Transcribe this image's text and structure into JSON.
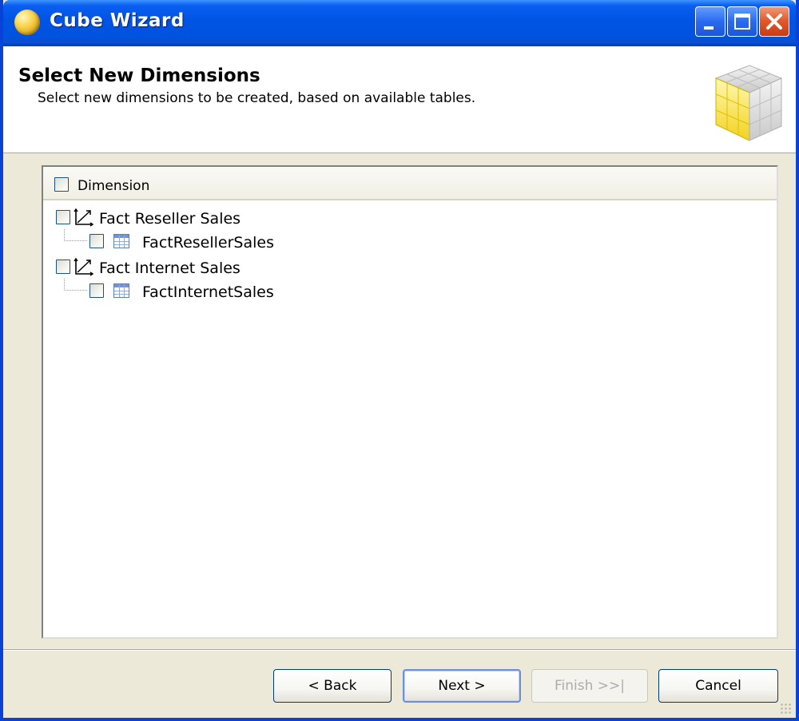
{
  "window": {
    "title": "Cube Wizard",
    "icon": "cube-app-icon",
    "controls": [
      "minimize-icon",
      "maximize-icon",
      "close-icon"
    ]
  },
  "header": {
    "title": "Select New Dimensions",
    "subtitle": "Select new dimensions to be created, based on available tables.",
    "icon": "cube-grid-icon"
  },
  "panel": {
    "column_header": "Dimension",
    "items": [
      {
        "label": "Fact Reseller Sales",
        "checked": false,
        "icon": "dimension-icon",
        "children": [
          {
            "label": "FactResellerSales",
            "checked": false,
            "icon": "table-icon"
          }
        ]
      },
      {
        "label": "Fact Internet Sales",
        "checked": false,
        "icon": "dimension-icon",
        "children": [
          {
            "label": "FactInternetSales",
            "checked": false,
            "icon": "table-icon"
          }
        ]
      }
    ]
  },
  "buttons": {
    "back": "< Back",
    "next": "Next >",
    "finish": "Finish >>|",
    "cancel": "Cancel"
  },
  "colors": {
    "titlebar": "#0054e3",
    "dialog_bg": "#ece9d8",
    "disabled_text": "#acacac"
  }
}
